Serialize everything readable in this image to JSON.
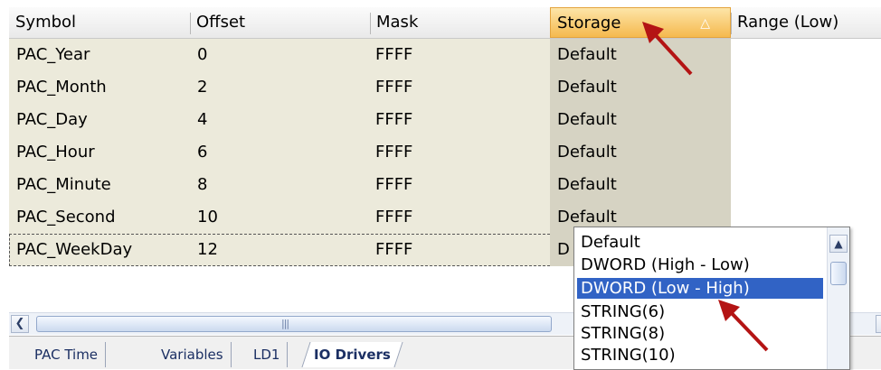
{
  "grid": {
    "columns": [
      {
        "label": "Symbol"
      },
      {
        "label": "Offset"
      },
      {
        "label": "Mask"
      },
      {
        "label": "Storage",
        "sorted": true
      },
      {
        "label": "Range (Low)"
      }
    ],
    "rows": [
      {
        "symbol": "PAC_Year",
        "offset": "0",
        "mask": "FFFF",
        "storage": "Default"
      },
      {
        "symbol": "PAC_Month",
        "offset": "2",
        "mask": "FFFF",
        "storage": "Default"
      },
      {
        "symbol": "PAC_Day",
        "offset": "4",
        "mask": "FFFF",
        "storage": "Default"
      },
      {
        "symbol": "PAC_Hour",
        "offset": "6",
        "mask": "FFFF",
        "storage": "Default"
      },
      {
        "symbol": "PAC_Minute",
        "offset": "8",
        "mask": "FFFF",
        "storage": "Default"
      },
      {
        "symbol": "PAC_Second",
        "offset": "10",
        "mask": "FFFF",
        "storage": "Default"
      },
      {
        "symbol": "PAC_WeekDay",
        "offset": "12",
        "mask": "FFFF",
        "storage": "D"
      }
    ]
  },
  "storage_dropdown": {
    "options": [
      "Default",
      "DWORD (High - Low)",
      "DWORD (Low - High)",
      "STRING(6)",
      "STRING(8)",
      "STRING(10)"
    ],
    "selected": "DWORD (Low - High)"
  },
  "tabs": [
    "PAC Time",
    "Variables",
    "LD1",
    "IO Drivers"
  ],
  "active_tab": "IO Drivers",
  "icons": {
    "sort": "sort-ascending-icon",
    "scroll_left": "chevron-left-icon",
    "scroll_right": "chevron-right-icon",
    "scroll_up": "chevron-up-icon",
    "annotation": "red-arrow-icon"
  },
  "colors": {
    "row_bg": "#eceadb",
    "storage_col_bg": "#d6d3c3",
    "header_sorted": "#f5b94e",
    "selection": "#3163c5",
    "arrow": "#b41414"
  }
}
